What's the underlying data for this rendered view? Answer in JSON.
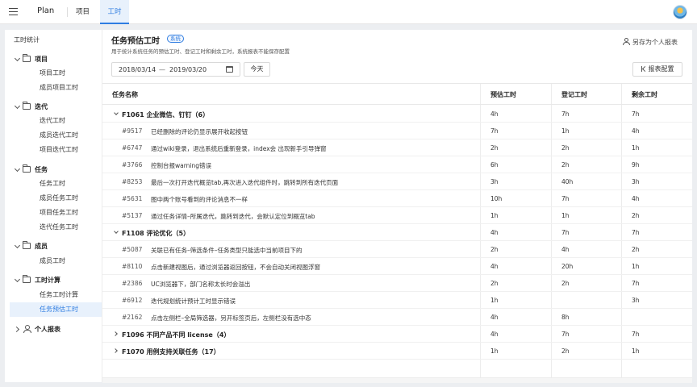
{
  "topbar": {
    "brand": "Plan",
    "tabs": [
      {
        "label": "项目",
        "active": false
      },
      {
        "label": "工时",
        "active": true
      }
    ],
    "accent_color": "#2f7de1"
  },
  "sidebar": {
    "title": "工时统计",
    "groups": [
      {
        "label": "项目",
        "icon": "folder-icon",
        "expanded": true,
        "items": [
          "项目工时",
          "成员项目工时"
        ]
      },
      {
        "label": "迭代",
        "icon": "folder-icon",
        "expanded": true,
        "items": [
          "迭代工时",
          "成员迭代工时",
          "项目迭代工时"
        ]
      },
      {
        "label": "任务",
        "icon": "folder-icon",
        "expanded": true,
        "items": [
          "任务工时",
          "成员任务工时",
          "项目任务工时",
          "迭代任务工时"
        ]
      },
      {
        "label": "成员",
        "icon": "folder-icon",
        "expanded": true,
        "items": [
          "成员工时"
        ]
      },
      {
        "label": "工时计算",
        "icon": "folder-icon",
        "expanded": true,
        "items": [
          "任务工时计算",
          "任务预估工时"
        ]
      },
      {
        "label": "个人报表",
        "icon": "user-icon",
        "expanded": false,
        "items": []
      }
    ],
    "active_item": "任务预估工时"
  },
  "main": {
    "title": "任务预估工时",
    "tag": "系统",
    "subtitle": "用于统计系统任务的预估工时、登记工时和剩余工时，系统报表不能保存配置",
    "save_personal": "另存为个人报表",
    "date_start": "2018/03/14",
    "date_sep": "—",
    "date_end": "2019/03/20",
    "today_btn": "今天",
    "report_config_btn": "报表配置"
  },
  "table": {
    "columns": [
      "任务名称",
      "预估工时",
      "登记工时",
      "剩余工时"
    ],
    "rows": [
      {
        "kind": "group",
        "expanded": true,
        "name": "F1061 企业微信、钉钉（6）",
        "est": "4h",
        "logged": "7h",
        "remain": "7h"
      },
      {
        "kind": "task",
        "id": "#9517",
        "title": "已经删除的评论仍显示展开收起按钮",
        "est": "7h",
        "logged": "1h",
        "remain": "4h"
      },
      {
        "kind": "task",
        "id": "#6747",
        "title": "通过wiki登录，退出系统后重新登录，index会 出现新手引导弹窗",
        "est": "2h",
        "logged": "2h",
        "remain": "1h"
      },
      {
        "kind": "task",
        "id": "#3766",
        "title": "控制台报warning错误",
        "est": "6h",
        "logged": "2h",
        "remain": "9h"
      },
      {
        "kind": "task",
        "id": "#8253",
        "title": "最后一次打开迭代概览tab,再次进入迭代组件时，跳转到所有迭代页面",
        "est": "3h",
        "logged": "40h",
        "remain": "3h"
      },
      {
        "kind": "task",
        "id": "#5631",
        "title": "图中两个账号看到的评论消息不一样",
        "est": "10h",
        "logged": "7h",
        "remain": "4h"
      },
      {
        "kind": "task",
        "id": "#5137",
        "title": "通过任务详情–所属迭代，跳转到迭代，会默认定位到概览tab",
        "est": "1h",
        "logged": "1h",
        "remain": "2h"
      },
      {
        "kind": "group",
        "expanded": true,
        "name": "F1108 评论优化（5）",
        "est": "4h",
        "logged": "7h",
        "remain": "7h"
      },
      {
        "kind": "task",
        "id": "#5087",
        "title": "关联已有任务–筛选条件–任务类型只能选中当前项目下的",
        "est": "2h",
        "logged": "4h",
        "remain": "2h"
      },
      {
        "kind": "task",
        "id": "#8110",
        "title": "点击新建视图后，通过浏览器返回按钮，不会自动关闭视图浮窗",
        "est": "4h",
        "logged": "20h",
        "remain": "1h"
      },
      {
        "kind": "task",
        "id": "#2386",
        "title": "UC浏览器下，部门名称太长时会溢出",
        "est": "2h",
        "logged": "2h",
        "remain": "7h"
      },
      {
        "kind": "task",
        "id": "#6912",
        "title": "迭代规划统计预计工时显示错误",
        "est": "1h",
        "logged": "",
        "remain": "3h"
      },
      {
        "kind": "task",
        "id": "#2162",
        "title": "点击左侧栏–全局筛选器，另开标签页后，左侧栏没有选中态",
        "est": "4h",
        "logged": "8h",
        "remain": ""
      },
      {
        "kind": "group",
        "expanded": false,
        "name": "F1096 不同产品不同 license（4）",
        "est": "4h",
        "logged": "7h",
        "remain": "7h"
      },
      {
        "kind": "group",
        "expanded": false,
        "name": "F1070 用例支持关联任务（17）",
        "est": "1h",
        "logged": "2h",
        "remain": "1h"
      }
    ]
  }
}
